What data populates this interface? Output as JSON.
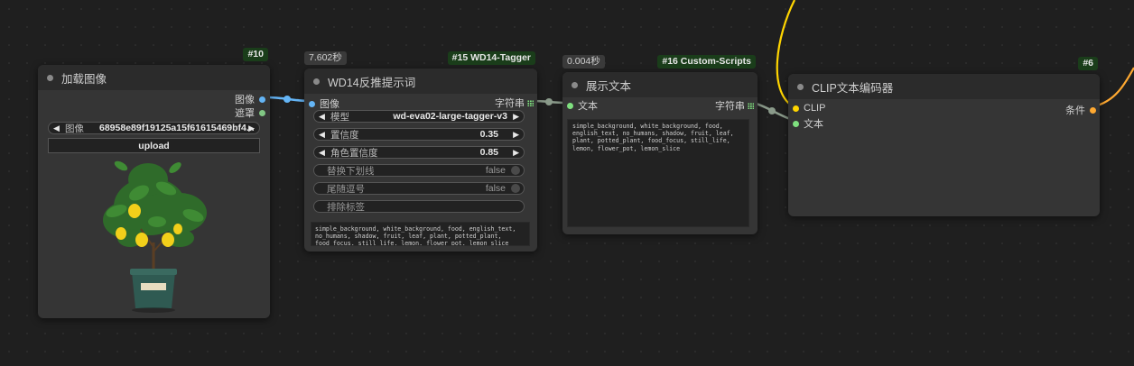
{
  "nodes": {
    "load_image": {
      "badge": "#10",
      "title": "加载图像",
      "outputs": {
        "image": "图像",
        "mask": "遮罩"
      },
      "image_widget": {
        "label": "图像",
        "value": "68958e89f19125a15f61615469bf4..."
      },
      "upload_label": "upload",
      "preview": "lemon tree in green pot"
    },
    "wd14": {
      "badge": "#15 WD14-Tagger",
      "time": "7.602秒",
      "title": "WD14反推提示词",
      "input_image": "图像",
      "output_string": "字符串",
      "widgets": {
        "model": {
          "label": "模型",
          "value": "wd-eva02-large-tagger-v3"
        },
        "threshold": {
          "label": "置信度",
          "value": "0.35"
        },
        "char_threshold": {
          "label": "角色置信度",
          "value": "0.85"
        },
        "replace_underscore": {
          "label": "替换下划线",
          "value": "false"
        },
        "trailing_comma": {
          "label": "尾随逗号",
          "value": "false"
        },
        "exclude_tags": {
          "label": "排除标签"
        }
      },
      "output_text": "simple_background, white_background, food, english_text, no_humans, shadow, fruit, leaf, plant, potted_plant, food_focus, still_life, lemon, flower_pot, lemon_slice"
    },
    "show_text": {
      "badge": "#16 Custom-Scripts",
      "time": "0.004秒",
      "title": "展示文本",
      "input_text": "文本",
      "output_string": "字符串",
      "text": "simple_background, white_background, food, english_text, no_humans, shadow, fruit, leaf, plant, potted_plant, food_focus, still_life, lemon, flower_pot, lemon_slice"
    },
    "clip_encode": {
      "badge": "#6",
      "title": "CLIP文本编码器",
      "input_clip": "CLIP",
      "input_text": "文本",
      "output_condition": "条件"
    }
  },
  "colors": {
    "image_slot": "#64b5f6",
    "mask_slot": "#81c784",
    "string_slot": "#7fe07f",
    "clip_slot": "#ffd500",
    "condition_slot": "#ffa931"
  }
}
